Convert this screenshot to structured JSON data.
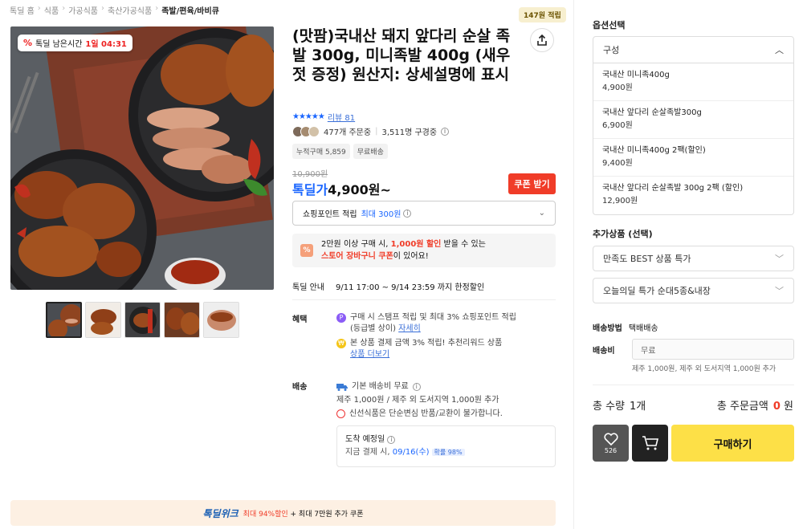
{
  "breadcrumb": [
    "톡딜 홈",
    "식품",
    "가공식품",
    "축산가공식품",
    "족발/편육/바비큐"
  ],
  "points_badge": "147원 적립",
  "timer": {
    "icon": "percent-icon",
    "label": "톡딜 남은시간",
    "time": "1일 04:31"
  },
  "product": {
    "title": "(맛팜)국내산 돼지 앞다리 순살 족발 300g, 미니족발 400g (새우젓 증정) 원산지: 상세설명에 표시",
    "stars": "★★★★★",
    "review_link": "리뷰 81",
    "orders": "477개 주문중",
    "subscribers": "3,511명 구경중",
    "chips": [
      "누적구매 5,859",
      "무료배송"
    ],
    "original_price": "10,900원",
    "price_label": "톡딜가",
    "price": "4,900원~",
    "coupon_button": "쿠폰 받기",
    "point_select": {
      "label": "쇼핑포인트 적립",
      "highlight": "최대 300원"
    },
    "promo": {
      "line1_a": "2만원 이상 구매 시, ",
      "line1_b": "1,000원 할인",
      "line1_c": " 받을 수 있는",
      "line2_a": "스토어 장바구니 쿠폰",
      "line2_b": "이 있어요!"
    },
    "deal": {
      "label": "톡딜 안내",
      "text": "9/11 17:00 ~ 9/14 23:59 까지 한정할인"
    },
    "benefit": {
      "label": "혜택",
      "item1_a": "구매 시 스탬프 적립 및 최대 3% 쇼핑포인트 적립",
      "item1_b": "(등급별 상이)",
      "item1_link": "자세히",
      "item2_a": "본 상품 결제 금액 3% 적립! 추천리워드 상품",
      "item2_link": "상품 더보기"
    },
    "shipping": {
      "label": "배송",
      "line1": "기본 배송비 무료",
      "line2": "제주 1,000원 / 제주 외 도서지역 1,000원 추가",
      "line3": "신선식품은 단순변심 반품/교환이 불가합니다."
    },
    "arrival": {
      "title": "도착 예정일",
      "text_a": "지금 결제 시, ",
      "date": "09/16(수)",
      "rate": "확률 98%"
    }
  },
  "banner": {
    "brand": "톡딜위크",
    "text_a": "최대 94%할인",
    "text_b": " + 최대 7만원 추가 쿠폰"
  },
  "panel": {
    "options_title": "옵션선택",
    "option_group": "구성",
    "options": [
      {
        "name": "국내산 미니족400g",
        "price": "4,900원"
      },
      {
        "name": "국내산 앞다리 순살족발300g",
        "price": "6,900원"
      },
      {
        "name": "국내산 미니족400g 2팩(할인)",
        "price": "9,400원"
      },
      {
        "name": "국내산 앞다리 순살족발 300g 2팩 (할인)",
        "price": "12,900원"
      }
    ],
    "addon_title": "추가상품 (선택)",
    "addons": [
      "만족도 BEST 상품 특가",
      "오늘의딜 특가 순대5종&내장"
    ],
    "ship_method_label": "배송방법",
    "ship_method": "택배배송",
    "fee_label": "배송비",
    "fee_value": "무료",
    "fee_note": "제주 1,000원, 제주 외 도서지역 1,000원 추가",
    "total_qty_label": "총 수량",
    "total_qty": "1개",
    "total_price_label": "총 주문금액",
    "total_price": "0",
    "total_price_unit": "원",
    "like_count": "526",
    "buy_button": "구매하기"
  },
  "colors": {
    "accent_blue": "#1a66ff",
    "accent_red": "#f03c28",
    "buy_yellow": "#fde047"
  }
}
